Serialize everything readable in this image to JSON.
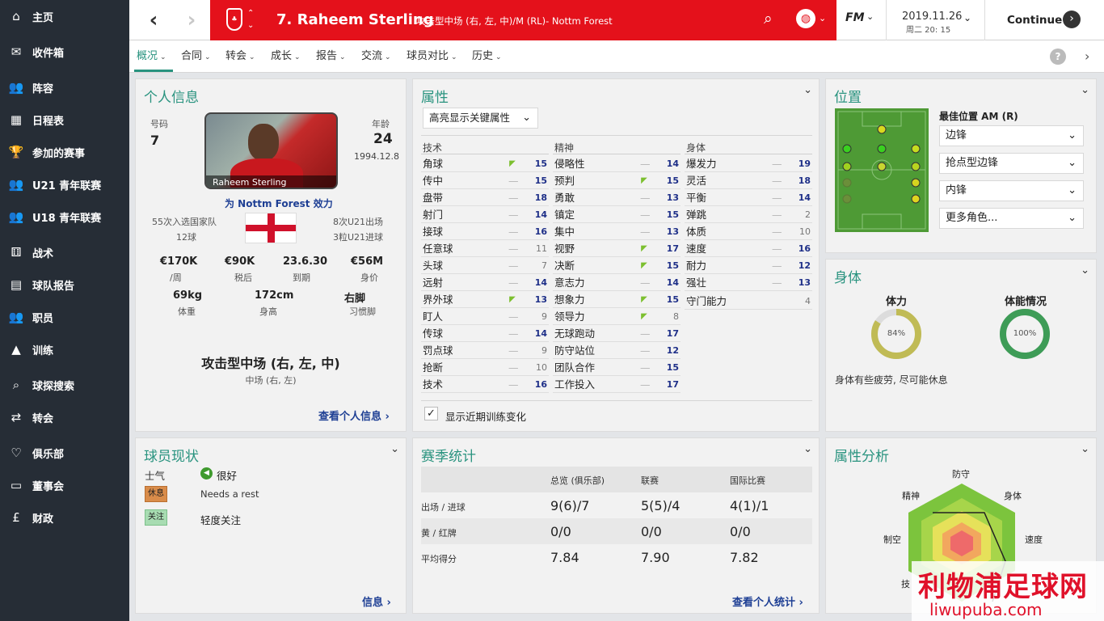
{
  "sidebar": {
    "items": [
      {
        "label": "主页",
        "icon": "home-icon",
        "glyph": "⌂"
      },
      {
        "label": "收件箱",
        "icon": "inbox-icon",
        "glyph": "✉"
      },
      {
        "label": "阵容",
        "icon": "squad-icon",
        "glyph": "👥"
      },
      {
        "label": "日程表",
        "icon": "calendar-icon",
        "glyph": "▦"
      },
      {
        "label": "参加的赛事",
        "icon": "trophy-icon",
        "glyph": "🏆"
      },
      {
        "label": "U21 青年联赛",
        "icon": "u21-icon",
        "glyph": "👥"
      },
      {
        "label": "U18 青年联赛",
        "icon": "u18-icon",
        "glyph": "👥"
      },
      {
        "label": "战术",
        "icon": "tactics-icon",
        "glyph": "⚅"
      },
      {
        "label": "球队报告",
        "icon": "report-icon",
        "glyph": "▤"
      },
      {
        "label": "职员",
        "icon": "staff-icon",
        "glyph": "👥"
      },
      {
        "label": "训练",
        "icon": "training-icon",
        "glyph": "▲"
      },
      {
        "label": "球探搜索",
        "icon": "search-icon",
        "glyph": "⌕"
      },
      {
        "label": "转会",
        "icon": "transfer-icon",
        "glyph": "⇄"
      },
      {
        "label": "俱乐部",
        "icon": "club-icon",
        "glyph": "♡"
      },
      {
        "label": "董事会",
        "icon": "board-icon",
        "glyph": "▭"
      },
      {
        "label": "财政",
        "icon": "finance-icon",
        "glyph": "£"
      }
    ]
  },
  "topbar": {
    "player_title": "7. Raheem Sterling",
    "player_subtitle": "攻击型中场 (右, 左, 中)/M (RL)- Nottm Forest",
    "fm_label": "FM",
    "date": "2019.11.26",
    "day_time": "周二 20: 15",
    "continue_label": "Continue"
  },
  "tabs": [
    {
      "label": "概况"
    },
    {
      "label": "合同"
    },
    {
      "label": "转会"
    },
    {
      "label": "成长"
    },
    {
      "label": "报告"
    },
    {
      "label": "交流"
    },
    {
      "label": "球员对比"
    },
    {
      "label": "历史"
    }
  ],
  "info": {
    "title": "个人信息",
    "number_label": "号码",
    "number": "7",
    "age_label": "年龄",
    "age": "24",
    "dob": "1994.12.8",
    "photo_caption": "Raheem Sterling",
    "plays_for": "为 Nottm Forest 效力",
    "caps": "55次入选国家队",
    "goals": "12球",
    "u21_apps": "8次U21出场",
    "u21_goals": "3粒U21进球",
    "stats": [
      {
        "value": "€170K",
        "label": "/周"
      },
      {
        "value": "€90K",
        "label": "税后"
      },
      {
        "value": "23.6.30",
        "label": "到期"
      },
      {
        "value": "€56M",
        "label": "身价"
      }
    ],
    "body": [
      {
        "value": "69kg",
        "label": "体重"
      },
      {
        "value": "172cm",
        "label": "身高"
      },
      {
        "value": "右脚",
        "label": "习惯脚"
      }
    ],
    "position_main": "攻击型中场 (右, 左, 中)",
    "position_sub": "中场 (右, 左)",
    "link": "查看个人信息"
  },
  "attributes": {
    "title": "属性",
    "dropdown": "高亮显示关键属性",
    "checkbox_label": "显示近期训练变化",
    "columns": [
      {
        "header": "技术",
        "rows": [
          {
            "name": "角球",
            "trend": "up",
            "value": "15"
          },
          {
            "name": "传中",
            "trend": "flat",
            "value": "15"
          },
          {
            "name": "盘带",
            "trend": "flat",
            "value": "18"
          },
          {
            "name": "射门",
            "trend": "flat",
            "value": "14"
          },
          {
            "name": "接球",
            "trend": "flat",
            "value": "16"
          },
          {
            "name": "任意球",
            "trend": "flat",
            "value": "11"
          },
          {
            "name": "头球",
            "trend": "flat",
            "value": "7"
          },
          {
            "name": "远射",
            "trend": "flat",
            "value": "14"
          },
          {
            "name": "界外球",
            "trend": "up",
            "value": "13"
          },
          {
            "name": "盯人",
            "trend": "flat",
            "value": "9"
          },
          {
            "name": "传球",
            "trend": "flat",
            "value": "14"
          },
          {
            "name": "罚点球",
            "trend": "flat",
            "value": "9"
          },
          {
            "name": "抢断",
            "trend": "flat",
            "value": "10"
          },
          {
            "name": "技术",
            "trend": "flat",
            "value": "16"
          }
        ]
      },
      {
        "header": "精神",
        "rows": [
          {
            "name": "侵略性",
            "trend": "flat",
            "value": "14"
          },
          {
            "name": "预判",
            "trend": "up",
            "value": "15"
          },
          {
            "name": "勇敢",
            "trend": "flat",
            "value": "13"
          },
          {
            "name": "镇定",
            "trend": "flat",
            "value": "15"
          },
          {
            "name": "集中",
            "trend": "flat",
            "value": "13"
          },
          {
            "name": "视野",
            "trend": "up",
            "value": "17"
          },
          {
            "name": "决断",
            "trend": "up",
            "value": "15"
          },
          {
            "name": "意志力",
            "trend": "flat",
            "value": "14"
          },
          {
            "name": "想象力",
            "trend": "up",
            "value": "15"
          },
          {
            "name": "领导力",
            "trend": "up",
            "value": "8"
          },
          {
            "name": "无球跑动",
            "trend": "flat",
            "value": "17"
          },
          {
            "name": "防守站位",
            "trend": "flat",
            "value": "12"
          },
          {
            "name": "团队合作",
            "trend": "flat",
            "value": "15"
          },
          {
            "name": "工作投入",
            "trend": "flat",
            "value": "17"
          }
        ]
      },
      {
        "header": "身体",
        "rows": [
          {
            "name": "爆发力",
            "trend": "flat",
            "value": "19"
          },
          {
            "name": "灵活",
            "trend": "flat",
            "value": "18"
          },
          {
            "name": "平衡",
            "trend": "flat",
            "value": "14"
          },
          {
            "name": "弹跳",
            "trend": "flat",
            "value": "2"
          },
          {
            "name": "体质",
            "trend": "flat",
            "value": "10"
          },
          {
            "name": "速度",
            "trend": "flat",
            "value": "16"
          },
          {
            "name": "耐力",
            "trend": "flat",
            "value": "12"
          },
          {
            "name": "强壮",
            "trend": "flat",
            "value": "13"
          },
          {
            "name": "守门能力",
            "trend": "none",
            "value": "4"
          }
        ]
      }
    ]
  },
  "position": {
    "title": "位置",
    "best_label": "最佳位置 AM (R)",
    "roles": [
      "边锋",
      "抢点型边锋",
      "内锋",
      "更多角色..."
    ]
  },
  "physical": {
    "title": "身体",
    "stamina_label": "体力",
    "stamina_value": "84%",
    "stamina_pct": 84,
    "condition_label": "体能情况",
    "condition_value": "100%",
    "condition_pct": 100,
    "note": "身体有些疲劳, 尽可能休息"
  },
  "status": {
    "title": "球员现状",
    "morale_label": "士气",
    "morale_value": "很好",
    "rest_badge": "休息",
    "rest_text": "Needs a rest",
    "concern_badge": "关注",
    "concern_text": "轻度关注",
    "link": "信息"
  },
  "season": {
    "title": "赛季统计",
    "headers": [
      "总览 (俱乐部)",
      "联赛",
      "国际比赛"
    ],
    "rows": [
      {
        "label": "出场 / 进球",
        "values": [
          "9(6)/7",
          "5(5)/4",
          "4(1)/1"
        ]
      },
      {
        "label": "黄 / 红牌",
        "values": [
          "0/0",
          "0/0",
          "0/0"
        ]
      },
      {
        "label": "平均得分",
        "values": [
          "7.84",
          "7.90",
          "7.82"
        ]
      }
    ],
    "link": "查看个人统计"
  },
  "analysis": {
    "title": "属性分析",
    "labels": [
      "防守",
      "身体",
      "速度",
      "制空",
      "精神",
      "技"
    ]
  },
  "watermark": {
    "text": "利物浦足球网",
    "url": "liwupuba.com"
  },
  "colors": {
    "accent": "#29937f",
    "red": "#e4111b",
    "sidebar": "#262d36",
    "link": "#1e3f94"
  }
}
